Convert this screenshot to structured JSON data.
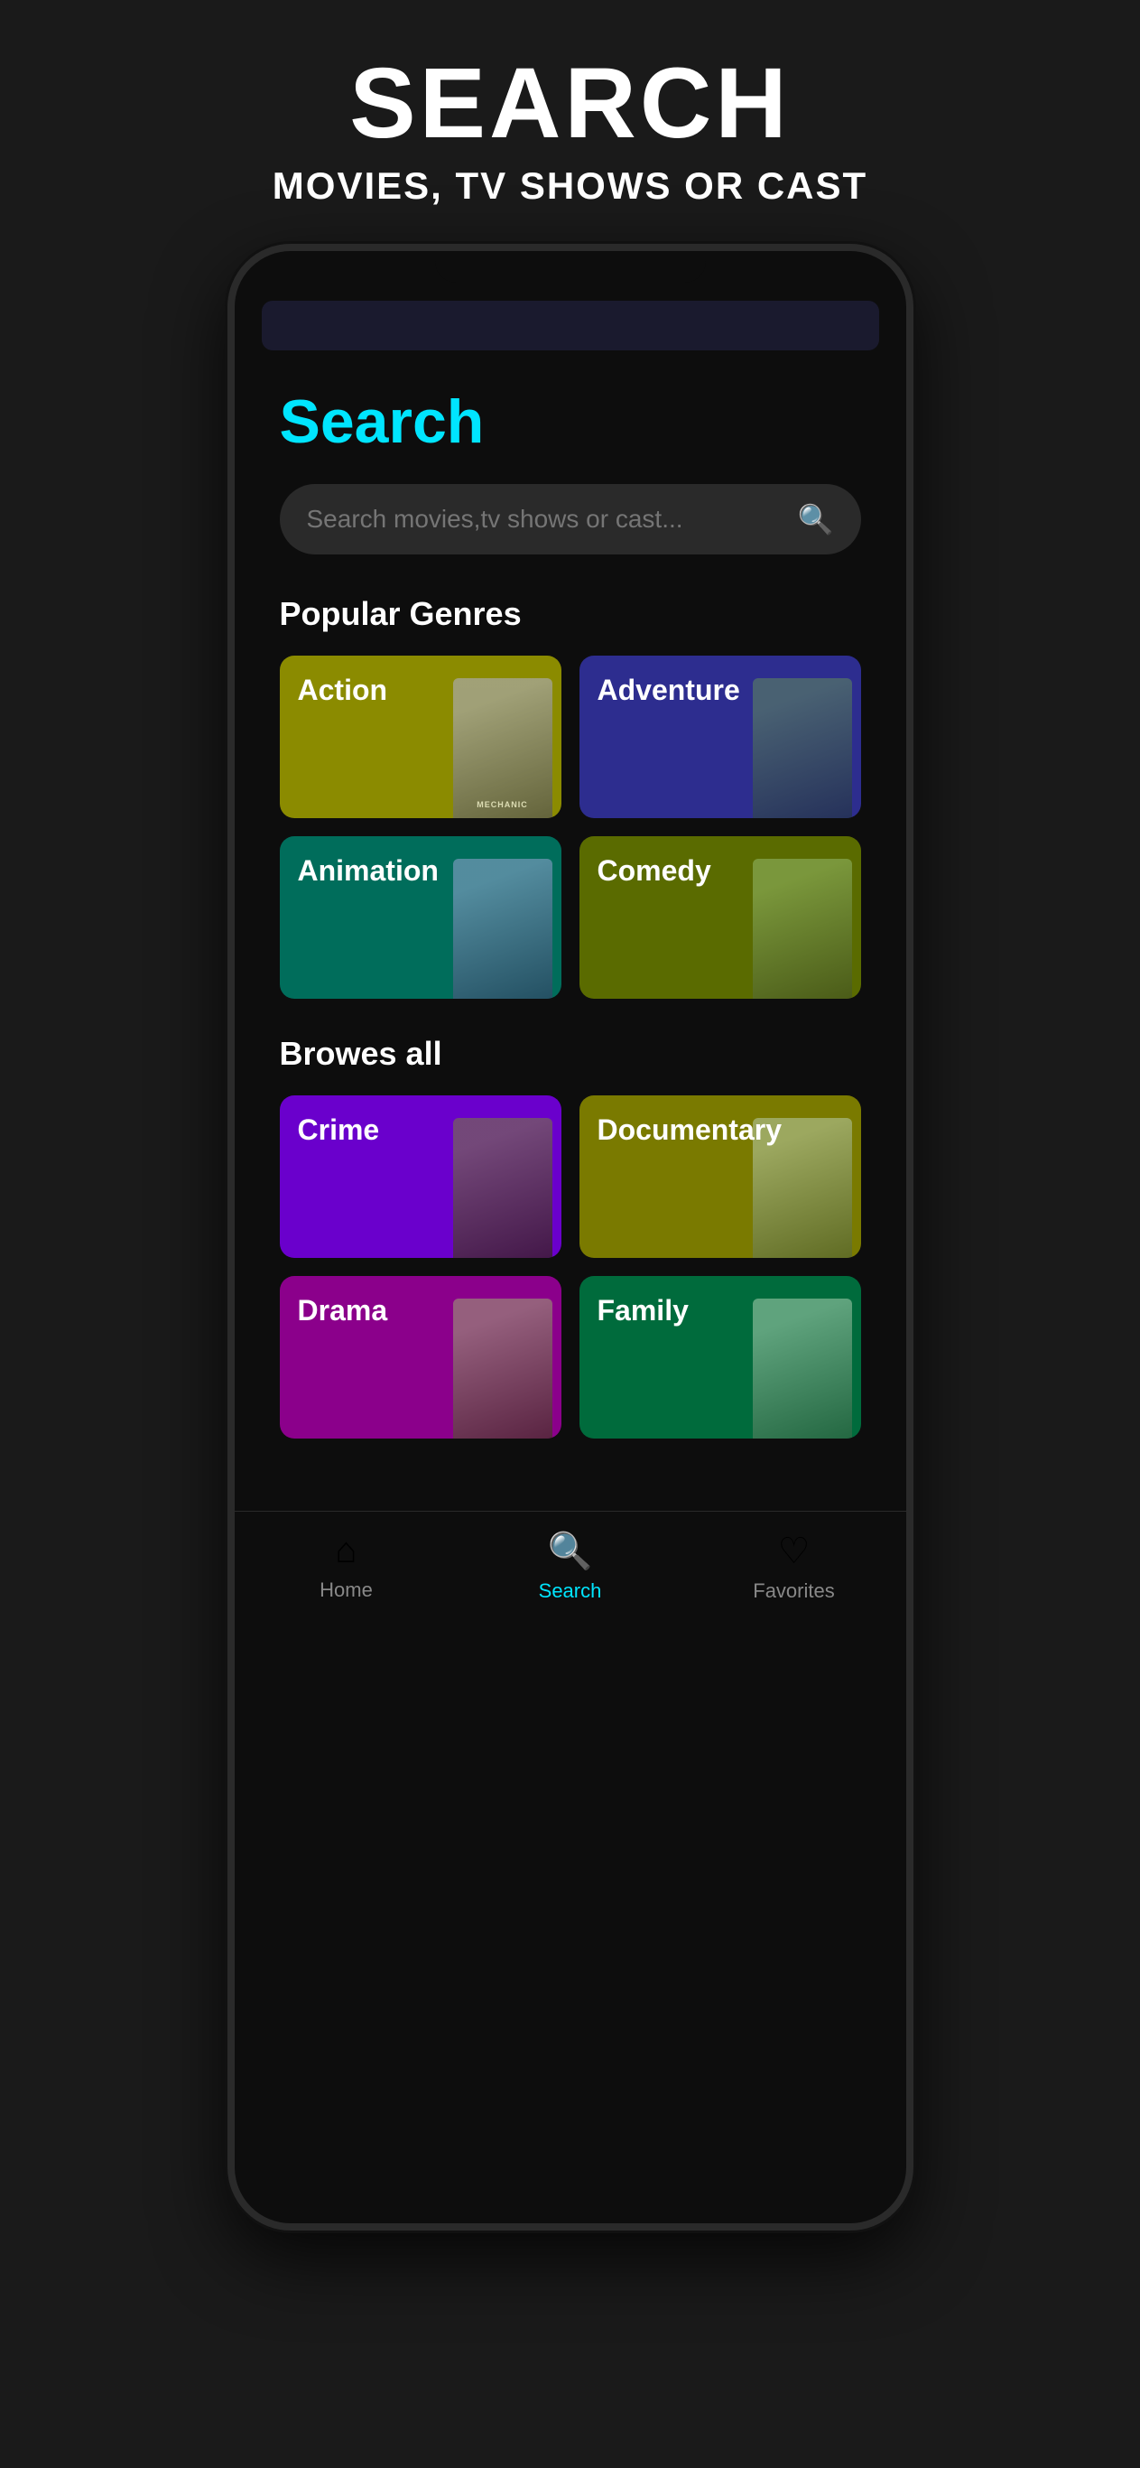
{
  "header": {
    "title": "SEARCH",
    "subtitle": "MOVIES, TV SHOWS OR CAST"
  },
  "page": {
    "title": "Search",
    "search_placeholder": "Search movies,tv shows or cast..."
  },
  "popular_genres": {
    "section_title": "Popular Genres",
    "items": [
      {
        "label": "Action",
        "card_class": "card-action",
        "poster_class": "poster-action"
      },
      {
        "label": "Adventure",
        "card_class": "card-adventure",
        "poster_class": "poster-adventure"
      },
      {
        "label": "Animation",
        "card_class": "card-animation",
        "poster_class": "poster-animation"
      },
      {
        "label": "Comedy",
        "card_class": "card-comedy",
        "poster_class": "poster-comedy"
      }
    ]
  },
  "browse_all": {
    "section_title": "Browes all",
    "items": [
      {
        "label": "Crime",
        "card_class": "card-crime",
        "poster_class": "poster-crime"
      },
      {
        "label": "Documentary",
        "card_class": "card-documentary",
        "poster_class": "poster-documentary"
      },
      {
        "label": "Drama",
        "card_class": "card-drama",
        "poster_class": "poster-drama"
      },
      {
        "label": "Family",
        "card_class": "card-family",
        "poster_class": "poster-family"
      }
    ]
  },
  "bottom_nav": {
    "items": [
      {
        "label": "Home",
        "icon": "⌂",
        "active": false
      },
      {
        "label": "Search",
        "icon": "🔍",
        "active": true
      },
      {
        "label": "Favorites",
        "icon": "♡",
        "active": false
      }
    ]
  },
  "colors": {
    "accent": "#00e5ff",
    "background": "#0d0d0d",
    "outer_bg": "#1a1a1a"
  }
}
